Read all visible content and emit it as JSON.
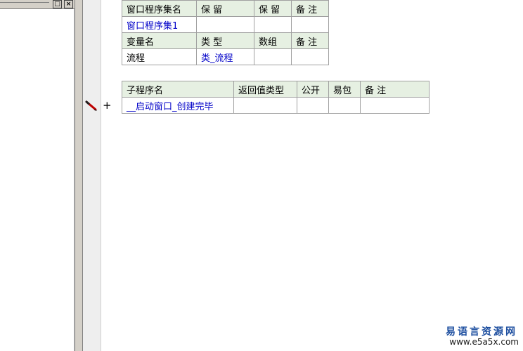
{
  "left_panel": {
    "buttons": {
      "restore": "□",
      "close": "×"
    }
  },
  "assembly_table": {
    "header": [
      "窗口程序集名",
      "保 留",
      "保 留",
      "备 注"
    ],
    "row": [
      "窗口程序集1",
      "",
      "",
      ""
    ],
    "var_header": [
      "变量名",
      "类 型",
      "数组",
      "备 注"
    ],
    "var_row": [
      "流程",
      "类_流程",
      "",
      ""
    ]
  },
  "subroutine_table": {
    "header": [
      "子程序名",
      "返回值类型",
      "公开",
      "易包",
      "备 注"
    ],
    "rows": [
      [
        "__启动窗口_创建完毕",
        "",
        "",
        "",
        ""
      ]
    ]
  },
  "margin": {
    "expand_symbol": "+"
  },
  "watermark": {
    "line1": "易语言资源网",
    "line2": "www.e5a5x.com"
  },
  "colors": {
    "header_bg": "#e6f0e2",
    "link_text": "#0000c8",
    "watermark": "#1e4fa0"
  }
}
